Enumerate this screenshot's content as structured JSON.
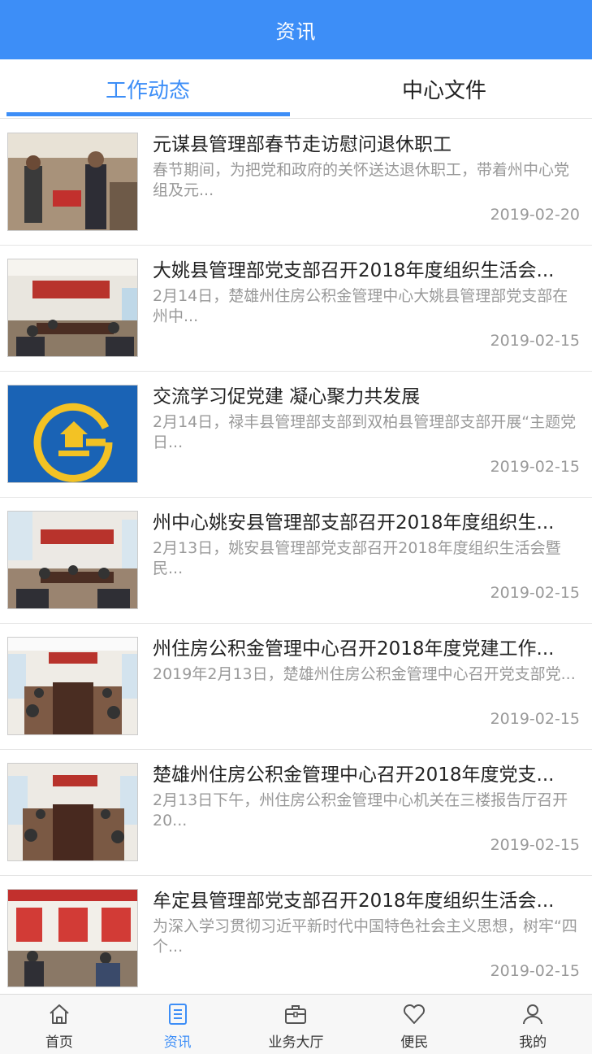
{
  "header": {
    "title": "资讯"
  },
  "tabs": [
    {
      "label": "工作动态"
    },
    {
      "label": "中心文件"
    }
  ],
  "colors": {
    "accent": "#3d8ef7",
    "logo_blue": "#1a63b5",
    "logo_yellow": "#f3c224"
  },
  "news": [
    {
      "title": "元谋县管理部春节走访慰问退休职工",
      "summary": "春节期间，为把党和政府的关怀送达退休职工，带着州中心党组及元...",
      "date": "2019-02-20",
      "image": "photo-visit"
    },
    {
      "title": "大姚县管理部党支部召开2018年度组织生活会...",
      "summary": "2月14日，楚雄州住房公积金管理中心大姚县管理部党支部在州中...",
      "date": "2019-02-15",
      "image": "photo-meeting"
    },
    {
      "title": "交流学习促党建 凝心聚力共发展",
      "summary": "2月14日，禄丰县管理部支部到双柏县管理部支部开展“主题党日...",
      "date": "2019-02-15",
      "image": "housing-fund-logo"
    },
    {
      "title": "州中心姚安县管理部支部召开2018年度组织生...",
      "summary": "2月13日，姚安县管理部党支部召开2018年度组织生活会暨民...",
      "date": "2019-02-15",
      "image": "photo-meeting"
    },
    {
      "title": "州住房公积金管理中心召开2018年度党建工作...",
      "summary": "2019年2月13日，楚雄州住房公积金管理中心召开党支部党...",
      "date": "2019-02-15",
      "image": "photo-conference"
    },
    {
      "title": "楚雄州住房公积金管理中心召开2018年度党支...",
      "summary": "2月13日下午，州住房公积金管理中心机关在三楼报告厅召开20...",
      "date": "2019-02-15",
      "image": "photo-conference"
    },
    {
      "title": "牟定县管理部党支部召开2018年度组织生活会...",
      "summary": "为深入学习贯彻习近平新时代中国特色社会主义思想，树牢“四个...",
      "date": "2019-02-15",
      "image": "photo-banner-meeting"
    }
  ],
  "bottom_nav": [
    {
      "label": "首页",
      "icon": "home-icon"
    },
    {
      "label": "资讯",
      "icon": "news-icon"
    },
    {
      "label": "业务大厅",
      "icon": "briefcase-icon"
    },
    {
      "label": "便民",
      "icon": "heart-icon"
    },
    {
      "label": "我的",
      "icon": "user-icon"
    }
  ]
}
